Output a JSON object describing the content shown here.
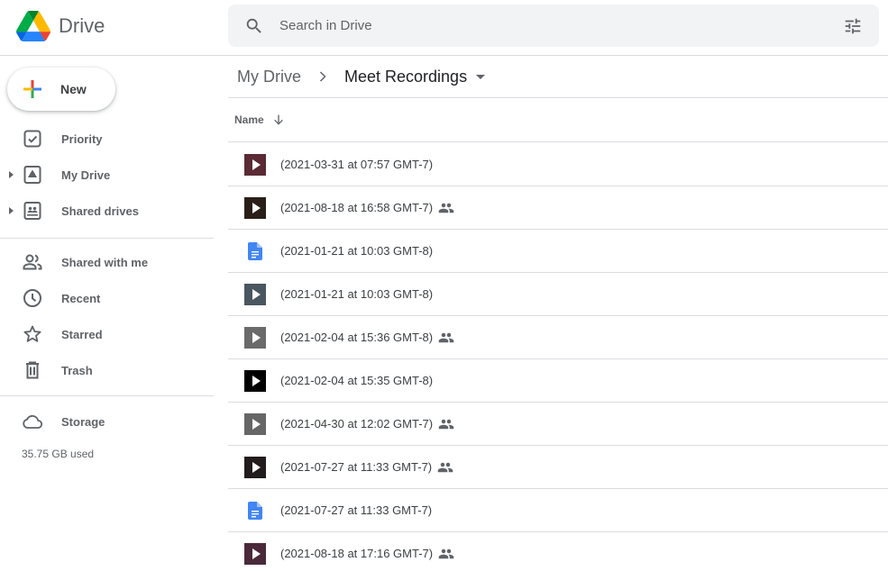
{
  "app": {
    "name": "Drive"
  },
  "search": {
    "placeholder": "Search in Drive"
  },
  "sidebar": {
    "new_label": "New",
    "items": [
      {
        "label": "Priority",
        "icon": "priority-icon",
        "expandable": false
      },
      {
        "label": "My Drive",
        "icon": "my-drive-icon",
        "expandable": true
      },
      {
        "label": "Shared drives",
        "icon": "shared-drives-icon",
        "expandable": true
      },
      {
        "label": "Shared with me",
        "icon": "shared-with-me-icon",
        "expandable": false
      },
      {
        "label": "Recent",
        "icon": "clock-icon",
        "expandable": false
      },
      {
        "label": "Starred",
        "icon": "star-icon",
        "expandable": false
      },
      {
        "label": "Trash",
        "icon": "trash-icon",
        "expandable": false
      },
      {
        "label": "Storage",
        "icon": "cloud-icon",
        "expandable": false
      }
    ],
    "storage_used": "35.75 GB used"
  },
  "breadcrumb": {
    "root": "My Drive",
    "current": "Meet Recordings"
  },
  "list": {
    "column_name": "Name",
    "sort": "descending",
    "files": [
      {
        "name": "(2021-03-31 at 07:57 GMT-7)",
        "type": "video",
        "shared": false,
        "thumb": "#5a2a35"
      },
      {
        "name": "(2021-08-18 at 16:58 GMT-7)",
        "type": "video",
        "shared": true,
        "thumb": "#2a1f18"
      },
      {
        "name": "(2021-01-21 at 10:03 GMT-8)",
        "type": "doc",
        "shared": false,
        "thumb": "#4285f4"
      },
      {
        "name": "(2021-01-21 at 10:03 GMT-8)",
        "type": "video",
        "shared": false,
        "thumb": "#4a5660"
      },
      {
        "name": "(2021-02-04 at 15:36 GMT-8)",
        "type": "video",
        "shared": true,
        "thumb": "#6a6a6a"
      },
      {
        "name": "(2021-02-04 at 15:35 GMT-8)",
        "type": "video",
        "shared": false,
        "thumb": "#000000"
      },
      {
        "name": "(2021-04-30 at 12:02 GMT-7)",
        "type": "video",
        "shared": true,
        "thumb": "#666666"
      },
      {
        "name": "(2021-07-27 at 11:33 GMT-7)",
        "type": "video",
        "shared": true,
        "thumb": "#231c1c"
      },
      {
        "name": "(2021-07-27 at 11:33 GMT-7)",
        "type": "doc",
        "shared": false,
        "thumb": "#4285f4"
      },
      {
        "name": "(2021-08-18 at 17:16 GMT-7)",
        "type": "video",
        "shared": true,
        "thumb": "#4a2a3a"
      }
    ]
  },
  "colors": {
    "doc_blue": "#4285f4",
    "text": "#3c4043",
    "muted": "#5f6368",
    "divider": "#dadce0"
  }
}
